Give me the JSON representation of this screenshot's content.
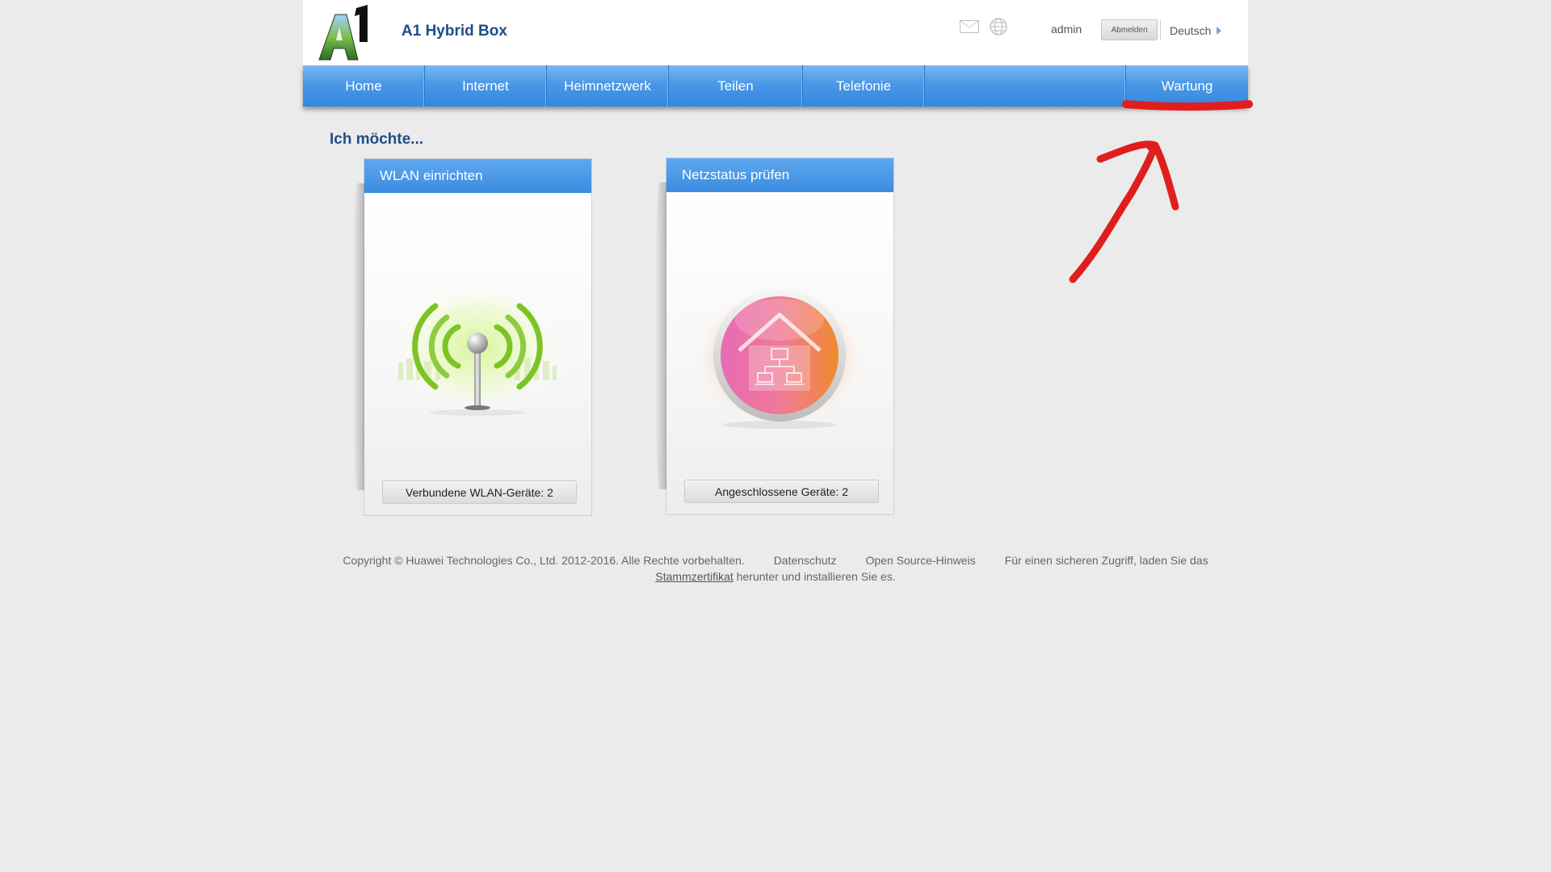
{
  "header": {
    "product_title": "A1 Hybrid Box",
    "user": "admin",
    "logout_label": "Abmelden",
    "language": "Deutsch",
    "icons": [
      "sms-icon",
      "globe-icon"
    ]
  },
  "nav": {
    "items": [
      {
        "label": "Home"
      },
      {
        "label": "Internet"
      },
      {
        "label": "Heimnetzwerk"
      },
      {
        "label": "Teilen"
      },
      {
        "label": "Telefonie"
      },
      {
        "label": "Wartung"
      }
    ]
  },
  "main": {
    "section_title": "Ich möchte...",
    "cards": [
      {
        "title": "WLAN einrichten",
        "footer": "Verbundene WLAN-Geräte: 2",
        "icon": "wifi-antenna-icon"
      },
      {
        "title": "Netzstatus prüfen",
        "footer": "Angeschlossene Geräte: 2",
        "icon": "home-network-icon"
      }
    ]
  },
  "footer": {
    "copyright": "Copyright © Huawei Technologies Co., Ltd. 2012-2016. Alle Rechte vorbehalten.",
    "privacy": "Datenschutz",
    "open_source": "Open Source-Hinweis",
    "cert_text_before": "Für einen sicheren Zugriff, laden Sie das",
    "cert_link": "Stammzertifikat",
    "cert_text_after": "herunter und installieren Sie es."
  },
  "colors": {
    "nav_blue": "#4a98e6",
    "title_blue": "#1d4f86",
    "annotation_red": "#e01e1e",
    "wifi_green": "#7cc423"
  }
}
